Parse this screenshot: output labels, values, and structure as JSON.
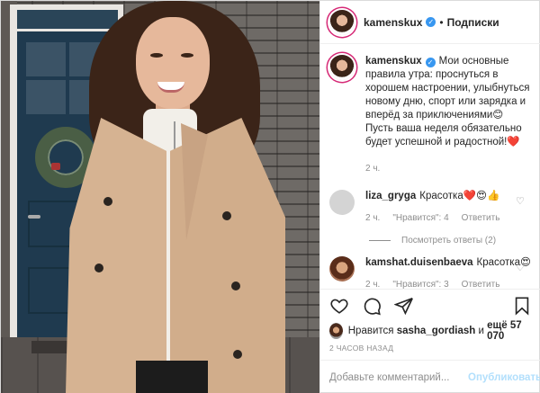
{
  "header": {
    "username": "kamenskux",
    "separator": "•",
    "follow_label": "Подписки"
  },
  "caption": {
    "username": "kamenskux",
    "text": "Мои основные правила утра: проснуться в хорошем настроении, улыбнуться новому дню, спорт или зарядка и вперёд за приключениями😊 Пусть ваша неделя обязательно будет успешной и радостной!❤️",
    "time": "2 ч."
  },
  "comments": [
    {
      "username": "liza_gryga",
      "text": "Красотка❤️😍👍",
      "time": "2 ч.",
      "likes": "\"Нравится\": 4",
      "reply": "Ответить",
      "view_replies": "Посмотреть ответы (2)"
    },
    {
      "username": "kamshat.duisenbaeva",
      "text": "Красотка😍",
      "time": "2 ч.",
      "likes": "\"Нравится\": 3",
      "reply": "Ответить"
    }
  ],
  "likes_line": {
    "prefix": "Нравится",
    "user": "sasha_gordiash",
    "middle": "и",
    "count": "ещё 57 070"
  },
  "timestamp": "2 ЧАСОВ НАЗАД",
  "add_comment": {
    "placeholder": "Добавьте комментарий...",
    "publish_label": "Опубликовать"
  },
  "icons": [
    "verified-badge-icon",
    "heart-icon",
    "comment-icon",
    "share-icon",
    "bookmark-icon"
  ],
  "colors": {
    "verified": "#3897f0",
    "link_disabled": "#b2dffc",
    "meta": "#8e8e8e"
  }
}
